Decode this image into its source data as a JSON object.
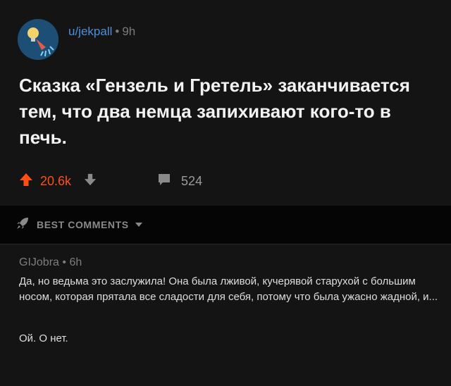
{
  "post": {
    "username": "u/jekpall",
    "separator": "•",
    "age": "9h",
    "title": "Сказка «Гензель и Гретель» заканчивается тем, что два немца запихивают кого-то в печь.",
    "upvotes": "20.6k",
    "comment_count": "524",
    "icons": {
      "avatar": "lightbulb-shower-avatar",
      "upvote": "upvote-arrow-icon",
      "downvote": "downvote-arrow-icon",
      "comment": "comment-bubble-icon"
    }
  },
  "sort": {
    "label": "BEST COMMENTS",
    "icon": "rocket-icon",
    "caret": "caret-down-icon"
  },
  "comment": {
    "author": "GIJobra",
    "separator": "•",
    "age": "6h",
    "paragraph1": "Да, но ведьма это заслужила! Она была лживой, кучерявой старухой с большим носом, которая прятала все сладости для себя, потому что была ужасно жадной, и...",
    "paragraph2": "Ой. О нет."
  },
  "colors": {
    "background": "#141414",
    "username": "#4f8ed8",
    "upvote": "#ff4f17",
    "muted": "#7a7a7a"
  }
}
